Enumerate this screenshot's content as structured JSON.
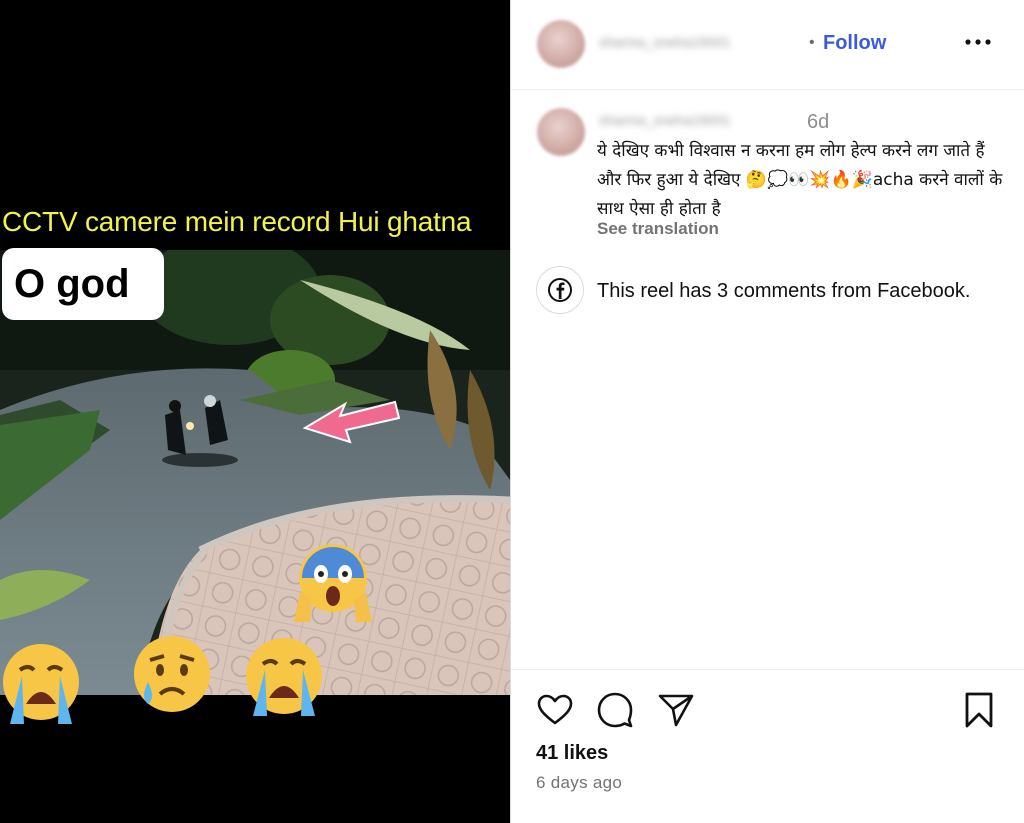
{
  "media": {
    "caption": "CCTV camere mein record Hui ghatna",
    "sticker": "O god",
    "emojis": [
      "😱",
      "😭",
      "😥",
      "😭"
    ]
  },
  "header": {
    "username": "sharma_sneha19001",
    "separator": "•",
    "follow_label": "Follow",
    "more_icon": "more-horizontal-icon"
  },
  "comment": {
    "username": "sharma_sneha19001",
    "time": "6d",
    "text": "ये देखिए कभी विश्वास न करना हम लोग हेल्प करने लग जाते हैं और फिर हुआ ये देखिए 🤔💭👀💥🔥🎉acha करने वालों के साथ ऐसा ही होता है",
    "see_translation": "See translation"
  },
  "facebook_note": {
    "icon": "facebook-icon",
    "text": "This reel has 3 comments from Facebook."
  },
  "actions": {
    "like_icon": "heart-icon",
    "comment_icon": "comment-icon",
    "share_icon": "send-icon",
    "save_icon": "bookmark-icon"
  },
  "likes": "41 likes",
  "post_age": "6 days ago",
  "colors": {
    "follow": "#3b5bdb",
    "caption_yellow": "#f3f24a",
    "arrow_pink": "#f06a8f"
  }
}
